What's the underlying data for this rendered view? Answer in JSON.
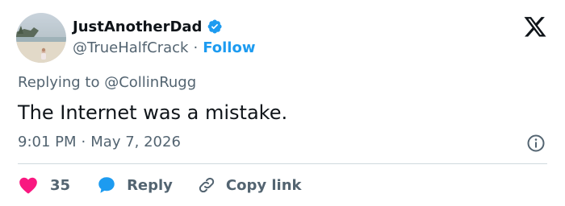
{
  "author": {
    "display_name": "JustAnotherDad",
    "handle": "@TrueHalfCrack",
    "separator": "·",
    "follow_label": "Follow",
    "verified": true
  },
  "tweet": {
    "reply_prefix": "Replying to ",
    "reply_to": "@CollinRugg",
    "text": "The Internet was a mistake.",
    "time": "9:01 PM",
    "time_separator": "·",
    "date": "May 7, 2026"
  },
  "actions": {
    "like_count": "35",
    "reply_label": "Reply",
    "copy_link_label": "Copy link"
  },
  "colors": {
    "accent": "#1d9bf0",
    "heart": "#f91880",
    "text_primary": "#0f1419",
    "text_secondary": "#536471"
  },
  "icons": [
    "verified-badge-icon",
    "x-logo-icon",
    "info-icon",
    "heart-icon",
    "reply-bubble-icon",
    "link-icon"
  ]
}
